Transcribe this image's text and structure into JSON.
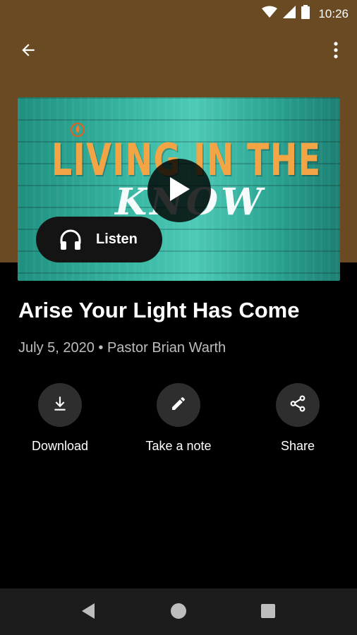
{
  "status_bar": {
    "time": "10:26",
    "icons": [
      "wifi-icon",
      "signal-icon",
      "battery-icon"
    ]
  },
  "toolbar": {
    "back_icon": "arrow-left-icon",
    "menu_icon": "more-vert-icon"
  },
  "hero": {
    "title_line1": "LIVING IN THE",
    "title_line2": "KNOW",
    "play_icon": "play-icon",
    "listen_label": "Listen",
    "listen_icon": "headphones-icon"
  },
  "sermon": {
    "title": "Arise Your Light Has Come",
    "meta": "July 5, 2020 • Pastor Brian Warth"
  },
  "actions": [
    {
      "label": "Download",
      "icon": "download-icon"
    },
    {
      "label": "Take a note",
      "icon": "pencil-icon"
    },
    {
      "label": "Share",
      "icon": "share-icon"
    }
  ],
  "nav": {
    "back_icon": "triangle-back-icon",
    "home_icon": "circle-home-icon",
    "recents_icon": "square-recents-icon"
  },
  "colors": {
    "header_bg": "#6a4a23",
    "background": "#000000",
    "hero_title": "#f3a545",
    "teal_wood": "#38b7a3",
    "action_circle": "#2e2e2e"
  }
}
